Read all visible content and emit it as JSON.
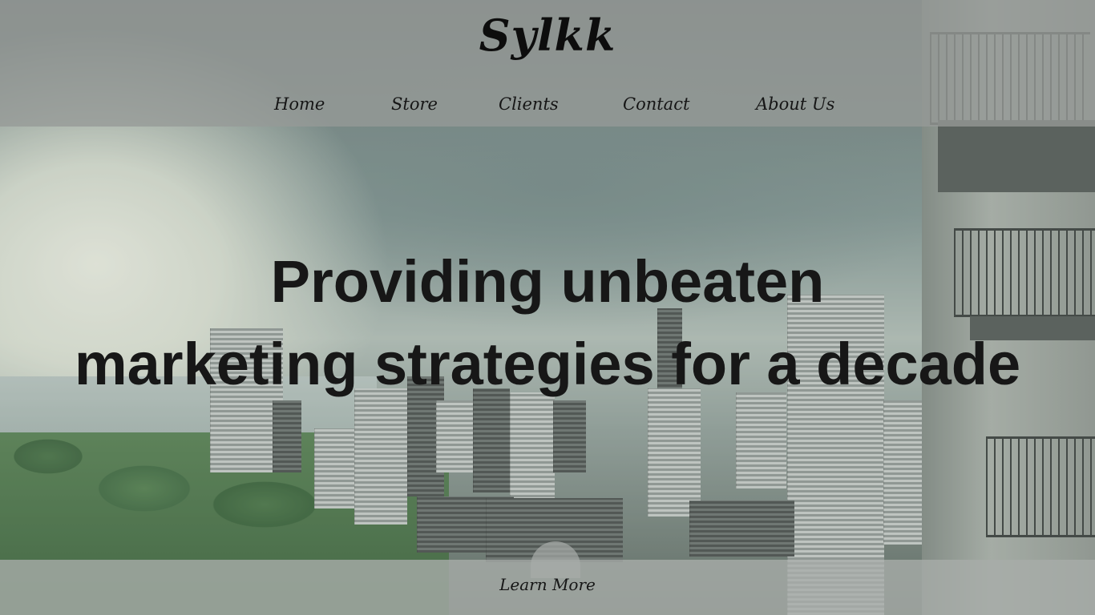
{
  "brand": {
    "logo_text": "Sylkk"
  },
  "nav": {
    "items": [
      {
        "label": "Home"
      },
      {
        "label": "Store"
      },
      {
        "label": "Clients"
      },
      {
        "label": "Contact"
      },
      {
        "label": "About Us"
      }
    ]
  },
  "hero": {
    "headline_line1": "Providing unbeaten",
    "headline_line2": "marketing strategies for a decade",
    "background": "city-skyline-photo"
  },
  "cta": {
    "learn_more_label": "Learn More"
  },
  "colors": {
    "text": "#171717",
    "header_band": "#969a97",
    "footer_band": "#a8aca9"
  }
}
